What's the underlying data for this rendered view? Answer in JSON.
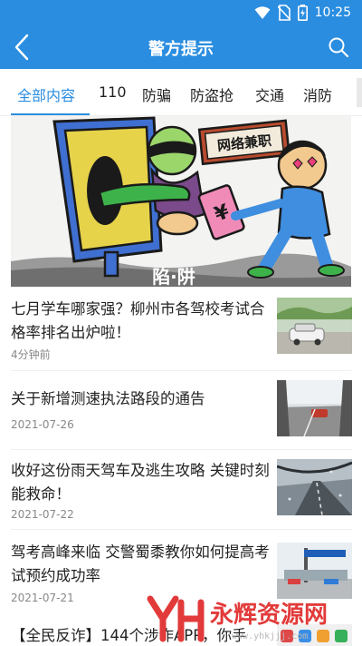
{
  "status_bar": {
    "time": "10:25"
  },
  "header": {
    "title": "警方提示"
  },
  "tabs": [
    {
      "label": "全部内容"
    },
    {
      "label": "110"
    },
    {
      "label": "防骗"
    },
    {
      "label": "防盗抢"
    },
    {
      "label": "交通"
    },
    {
      "label": "消防"
    }
  ],
  "banner": {
    "sign_text": "网络兼职",
    "caption": "陷·阱"
  },
  "news": [
    {
      "title": "七月学车哪家强？柳州市各驾校考试合格率排名出炉啦！",
      "time": "4分钟前"
    },
    {
      "title": "关于新增测速执法路段的通告",
      "time": "2021-07-26"
    },
    {
      "title": "收好这份雨天驾车及逃生攻略 关键时刻能救命！",
      "time": "2021-07-22"
    },
    {
      "title": "驾考高峰来临 交警蜀黍教你如何提高考试预约成功率",
      "time": "2021-07-21"
    },
    {
      "title": "【全民反诈】144个涉诈APP，你手"
    }
  ],
  "watermark": {
    "text": "永辉资源网",
    "url": "www.yhkjjj.com"
  },
  "colors": {
    "brand": "#2a8de0",
    "text": "#222222",
    "time": "#888888"
  }
}
